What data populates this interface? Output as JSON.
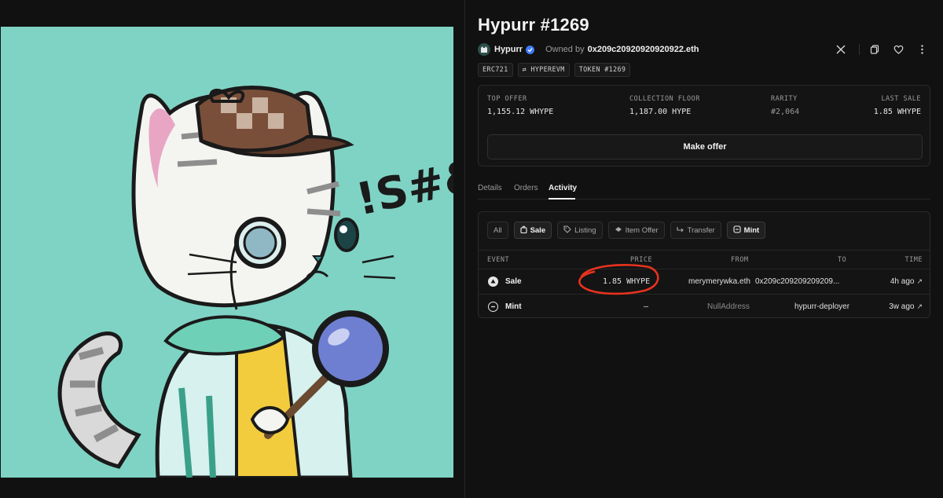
{
  "nft": {
    "title": "Hypurr #1269",
    "collection_name": "Hypurr",
    "owned_by_label": "Owned by",
    "owner": "0x209c20920920920922.eth",
    "tags": [
      "ERC721",
      "⇄ HYPEREVM",
      "TOKEN #1269"
    ],
    "action_icons": [
      "x-logo-icon",
      "copy-icon",
      "heart-icon",
      "more-icon"
    ]
  },
  "artwork": {
    "background_color": "#7fd3c4",
    "graffiti_text": "!S#&"
  },
  "stats": {
    "top_offer": {
      "label": "TOP OFFER",
      "value": "1,155.12 WHYPE"
    },
    "collection_floor": {
      "label": "COLLECTION FLOOR",
      "value": "1,187.00 HYPE"
    },
    "rarity": {
      "label": "RARITY",
      "value": "#2,064"
    },
    "last_sale": {
      "label": "LAST SALE",
      "value": "1.85 WHYPE"
    },
    "make_offer_label": "Make offer"
  },
  "tabs": [
    {
      "label": "Details",
      "active": false
    },
    {
      "label": "Orders",
      "active": false
    },
    {
      "label": "Activity",
      "active": true
    }
  ],
  "filters": [
    {
      "label": "All",
      "icon": "",
      "active": false
    },
    {
      "label": "Sale",
      "icon": "bag-icon",
      "active": true
    },
    {
      "label": "Listing",
      "icon": "tag-icon",
      "active": false
    },
    {
      "label": "Item Offer",
      "icon": "offer-icon",
      "active": false
    },
    {
      "label": "Transfer",
      "icon": "transfer-icon",
      "active": false
    },
    {
      "label": "Mint",
      "icon": "mint-icon",
      "active": true
    }
  ],
  "activity": {
    "headers": {
      "event": "EVENT",
      "price": "PRICE",
      "from": "FROM",
      "to": "TO",
      "time": "TIME"
    },
    "rows": [
      {
        "event": "Sale",
        "price": "1.85 WHYPE",
        "from": "merymerywka.eth",
        "to": "0x209c209209209209...",
        "time": "4h ago"
      },
      {
        "event": "Mint",
        "price": "–",
        "from": "NullAddress",
        "to": "hypurr-deployer",
        "time": "3w ago"
      }
    ]
  },
  "colors": {
    "background": "#111111",
    "panel": "#141414",
    "accent_verified": "#3d7bf5",
    "annotation": "#e8321e"
  }
}
